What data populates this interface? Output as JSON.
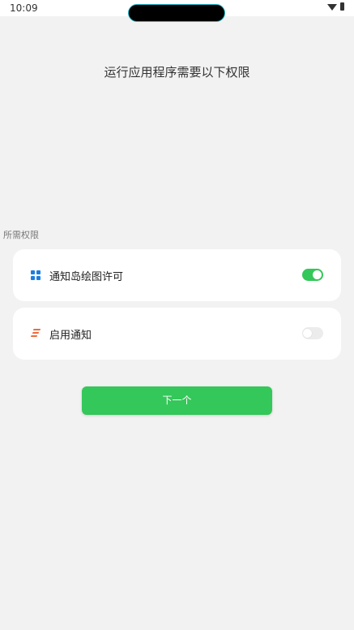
{
  "status_bar": {
    "time": "10:09",
    "icons": [
      "wifi-icon",
      "battery-icon"
    ]
  },
  "heading": "运行应用程序需要以下权限",
  "section_label": "所需权限",
  "permissions": [
    {
      "label": "通知岛绘图许可",
      "icon": "grid-icon",
      "enabled": true
    },
    {
      "label": "启用通知",
      "icon": "notification-lines-icon",
      "enabled": false
    }
  ],
  "next_button": "下一个",
  "colors": {
    "accent": "#34c759",
    "background": "#f2f2f2",
    "grid_icon": "#1a7fe0",
    "lines_icon": "#ef6b3c"
  }
}
